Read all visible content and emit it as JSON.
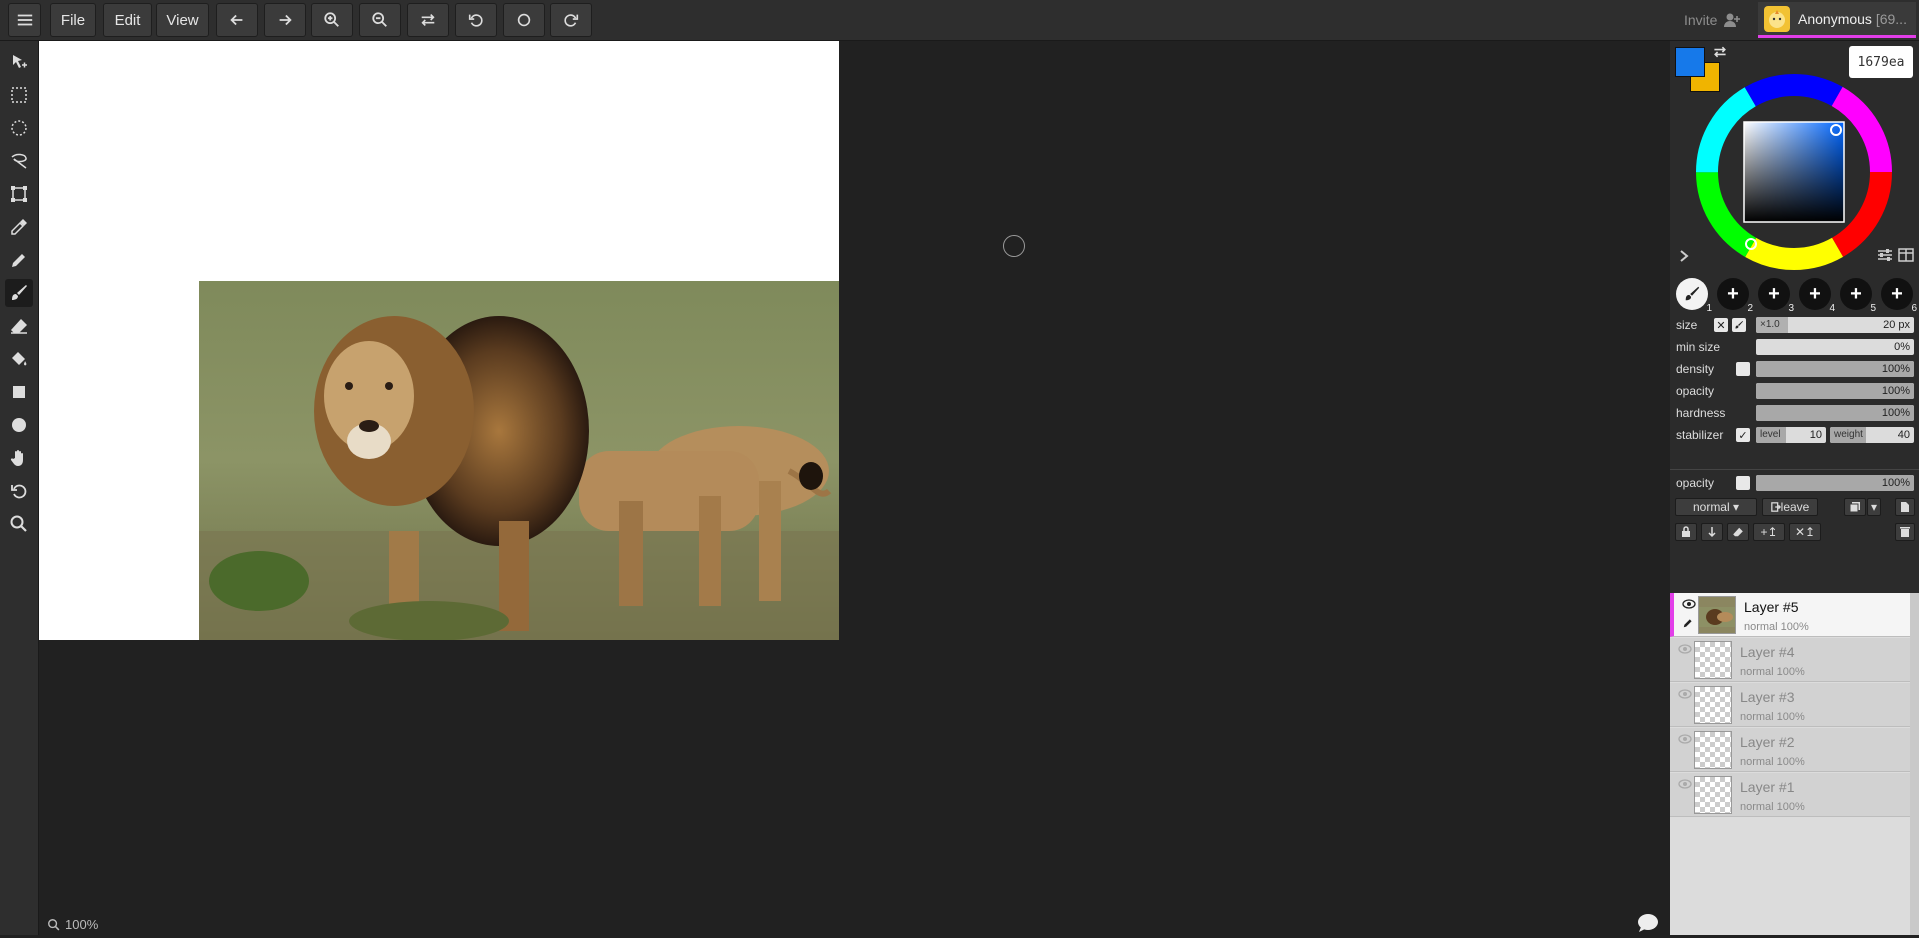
{
  "topbar": {
    "menu_icon": "hamburger-icon",
    "file_label": "File",
    "edit_label": "Edit",
    "view_label": "View",
    "invite_label": "Invite",
    "user_name": "Anonymous",
    "user_id": "[69..."
  },
  "colors": {
    "primary": "#1679ea",
    "secondary": "#f0b400",
    "hex_value": "1679ea",
    "accent": "#e23ee9"
  },
  "brush_slots": [
    "1",
    "2",
    "3",
    "4",
    "5",
    "6"
  ],
  "brush": {
    "size_label": "size",
    "size_multiplier": "×1.0",
    "size_value": "20 px",
    "min_size_label": "min size",
    "min_size_value": "0%",
    "density_label": "density",
    "density_value": "100%",
    "opacity_label": "opacity",
    "opacity_value": "100%",
    "hardness_label": "hardness",
    "hardness_value": "100%",
    "stabilizer_label": "stabilizer",
    "stabilizer_level_label": "level",
    "stabilizer_level_value": "10",
    "stabilizer_weight_label": "weight",
    "stabilizer_weight_value": "40"
  },
  "layer_controls": {
    "opacity_label": "opacity",
    "opacity_value": "100%",
    "blend_mode": "normal",
    "leave_label": "leave"
  },
  "layers": [
    {
      "name": "Layer #5",
      "meta": "normal 100%"
    },
    {
      "name": "Layer #4",
      "meta": "normal 100%"
    },
    {
      "name": "Layer #3",
      "meta": "normal 100%"
    },
    {
      "name": "Layer #2",
      "meta": "normal 100%"
    },
    {
      "name": "Layer #1",
      "meta": "normal 100%"
    }
  ],
  "status": {
    "zoom": "100%"
  }
}
